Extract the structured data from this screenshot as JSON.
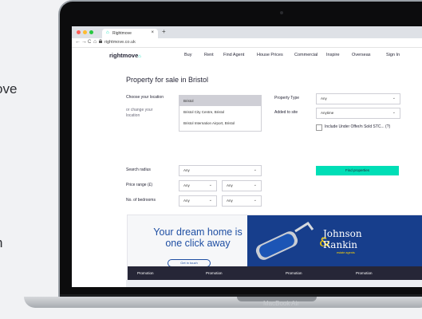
{
  "side": {
    "line1": "ove",
    "line2": "n"
  },
  "laptop": {
    "brand": "MacBook Air"
  },
  "browser": {
    "tab_title": "Rightmove",
    "tab_close": "×",
    "new_tab": "+",
    "url": "rightmove.co.uk",
    "icons": {
      "back": "←",
      "forward": "→",
      "reload": "C",
      "home": "⌂",
      "lock": "🔒"
    },
    "dot_colors": [
      "#ff5f57",
      "#febc2e",
      "#28c840"
    ]
  },
  "site": {
    "logo": "rightmove",
    "logo_mark": "⌂",
    "nav": [
      "Buy",
      "Rent",
      "Find Agent",
      "House Prices",
      "Commercial",
      "Inspire",
      "Overseas",
      "Sign In"
    ]
  },
  "search": {
    "title": "Property for sale in Bristol",
    "location_label": "Choose your location",
    "location_sublabel": "or change your location",
    "location_options": [
      "Bristol",
      "Bristol City Centre, Bristol",
      "Bristol Internation Airport, Bristol"
    ],
    "property_type_label": "Property Type",
    "property_type_value": "Any",
    "added_label": "Added to site",
    "added_value": "Anytime",
    "include_label": "Include Under Offer/n Sold STC... (?)",
    "find_button": "Find properties",
    "radius_label": "Search radius",
    "radius_value": "Any",
    "price_label": "Price range (£)",
    "price_min": "Any",
    "price_max": "Any",
    "beds_label": "No. of bedrooms",
    "beds_min": "Any",
    "beds_max": "Any",
    "chevron": "⌄"
  },
  "banner": {
    "line1": "Your dream home is",
    "line2": "one click away",
    "button": "Get in touch",
    "agent_line1": "Johnson",
    "agent_line2": "Rankin",
    "agent_amp": "&",
    "agent_sub": "estate agents",
    "promotions": [
      "Promotion",
      "Promotion",
      "Promotion",
      "Promotion"
    ]
  }
}
